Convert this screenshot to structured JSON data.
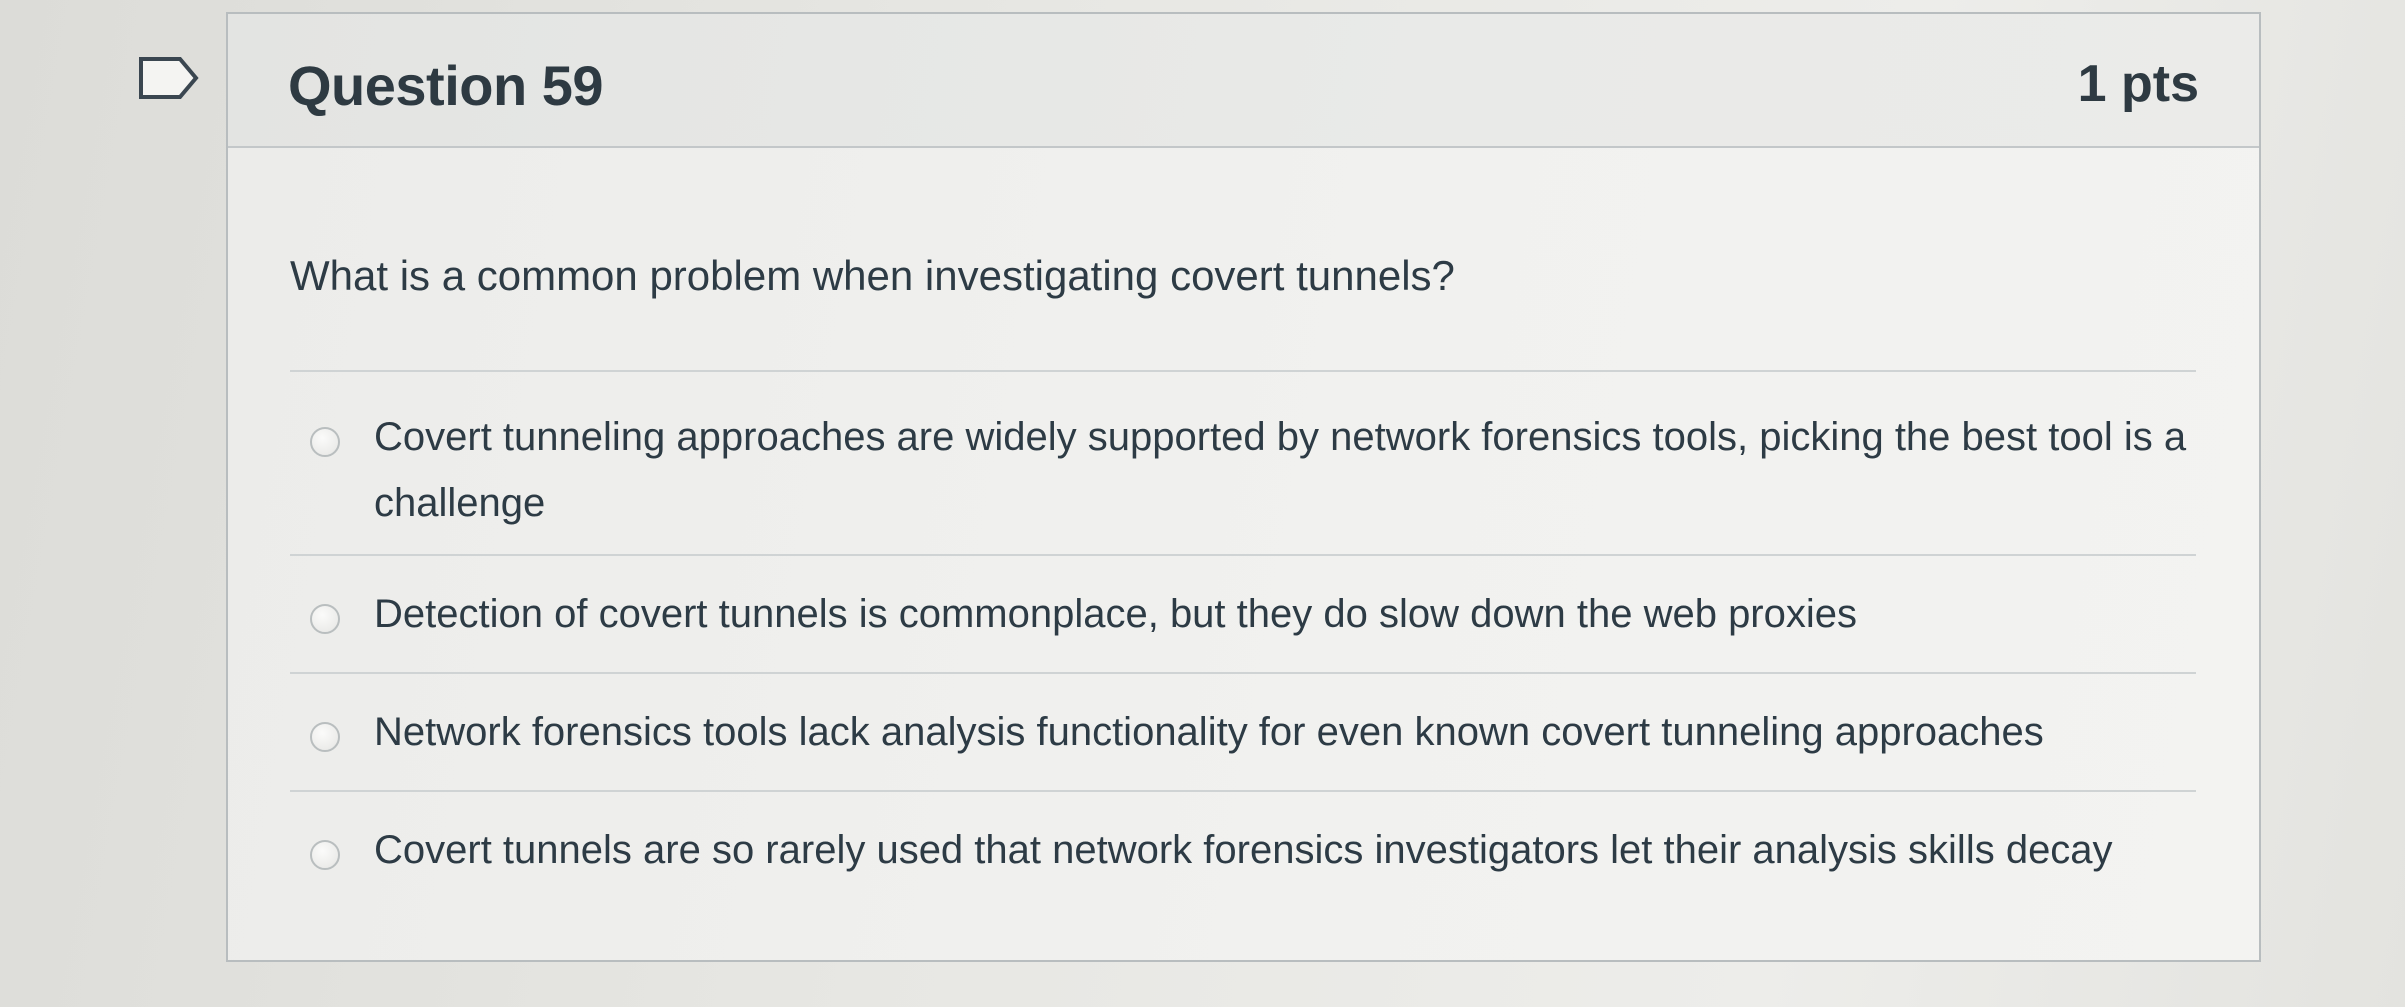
{
  "question": {
    "title": "Question 59",
    "points": "1 pts",
    "text": "What is a common problem when investigating covert tunnels?",
    "answers": [
      {
        "label": "Covert tunneling approaches are widely supported by network forensics tools, picking the best tool is a challenge",
        "selected": false
      },
      {
        "label": "Detection of covert tunnels is commonplace, but they do slow down the web proxies",
        "selected": false
      },
      {
        "label": "Network forensics tools lack analysis functionality for even known covert tunneling approaches",
        "selected": false
      },
      {
        "label": "Covert tunnels are so rarely used that network forensics investigators let their analysis skills decay",
        "selected": false
      }
    ]
  },
  "icons": {
    "bookmark": "bookmark-flag-icon",
    "radio": "radio-unchecked-icon"
  },
  "colors": {
    "text": "#2d3b45",
    "border": "#b8bdbf"
  }
}
